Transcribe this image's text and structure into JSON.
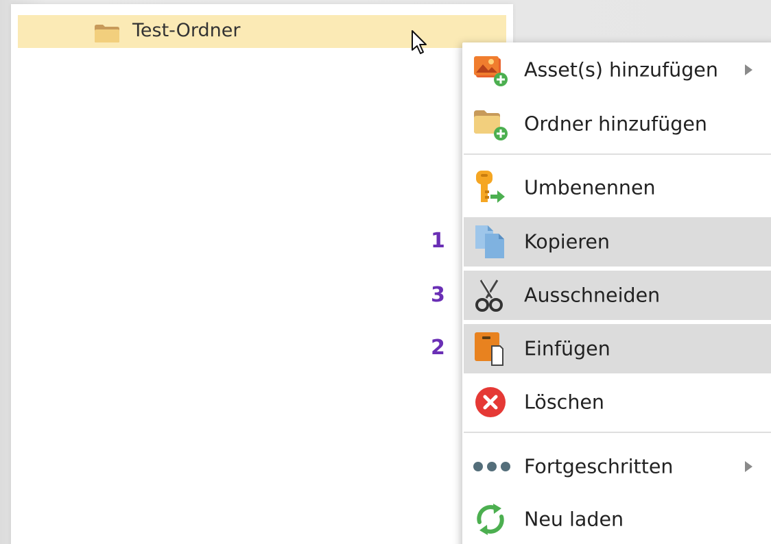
{
  "tree": {
    "folder_label": "Test-Ordner",
    "folder_icon": "folder-icon"
  },
  "menu": {
    "items": [
      {
        "label": "Asset(s) hinzufügen",
        "icon": "image-add-icon",
        "submenu": true
      },
      {
        "label": "Ordner hinzufügen",
        "icon": "folder-add-icon",
        "submenu": false
      },
      {
        "label": "Umbenennen",
        "icon": "key-rename-icon",
        "submenu": false
      },
      {
        "label": "Kopieren",
        "icon": "copy-icon",
        "submenu": false,
        "highlighted": true
      },
      {
        "label": "Ausschneiden",
        "icon": "scissors-icon",
        "submenu": false,
        "highlighted": true
      },
      {
        "label": "Einfügen",
        "icon": "paste-icon",
        "submenu": false,
        "highlighted": true
      },
      {
        "label": "Löschen",
        "icon": "delete-icon",
        "submenu": false
      },
      {
        "label": "Fortgeschritten",
        "icon": "more-icon",
        "submenu": true
      },
      {
        "label": "Neu laden",
        "icon": "reload-icon",
        "submenu": false
      }
    ]
  },
  "steps": {
    "copy": "1",
    "cut": "3",
    "paste": "2"
  },
  "colors": {
    "selection": "#fbeab5",
    "menu_highlight": "#dcdcdc",
    "step_number": "#6a2fb5"
  }
}
